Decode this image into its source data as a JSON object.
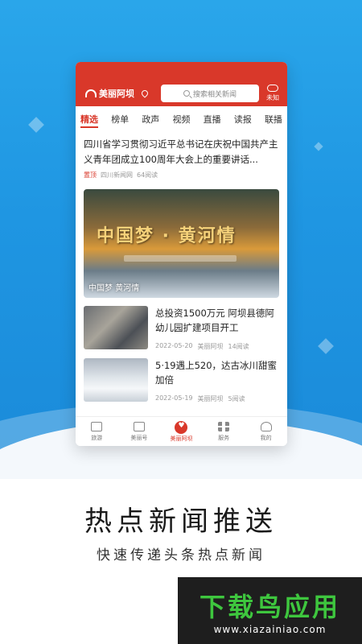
{
  "app": {
    "logo_text": "美丽阿坝",
    "search_placeholder": "搜索相关新闻",
    "weather_label": "未知"
  },
  "tabs": [
    "精选",
    "榜单",
    "政声",
    "视频",
    "直播",
    "读报",
    "联播"
  ],
  "lead": {
    "title": "四川省学习贯彻习近平总书记在庆祝中国共产主义青年团成立100周年大会上的重要讲话...",
    "pin_label": "置顶",
    "source": "四川新闻网",
    "reads": "64阅读"
  },
  "banner": {
    "overlay_title": "中国梦 · 黄河情",
    "caption": "中国梦 黄河情"
  },
  "news": [
    {
      "title": "总投资1500万元 阿坝县德阿幼儿园扩建项目开工",
      "date": "2022-05-20",
      "source": "美丽阿坝",
      "reads": "14阅读"
    },
    {
      "title": "5·19遇上520，达古冰川甜蜜加倍",
      "date": "2022-05-19",
      "source": "美丽阿坝",
      "reads": "5阅读"
    }
  ],
  "bottom_nav": [
    {
      "label": "旅游",
      "icon": "mountain-icon"
    },
    {
      "label": "美丽号",
      "icon": "plus-square-icon"
    },
    {
      "label": "美丽阿坝",
      "icon": "heart-icon"
    },
    {
      "label": "服务",
      "icon": "grid-icon"
    },
    {
      "label": "我的",
      "icon": "user-icon"
    }
  ],
  "promo": {
    "slogan": "热点新闻推送",
    "subtitle": "快速传递头条热点新闻"
  },
  "watermark": {
    "name": "下载鸟应用",
    "url": "www.xiazainiao.com"
  },
  "colors": {
    "accent": "#d9382a",
    "background_blue": "#1f96e2",
    "watermark_green": "#3ec63e"
  }
}
